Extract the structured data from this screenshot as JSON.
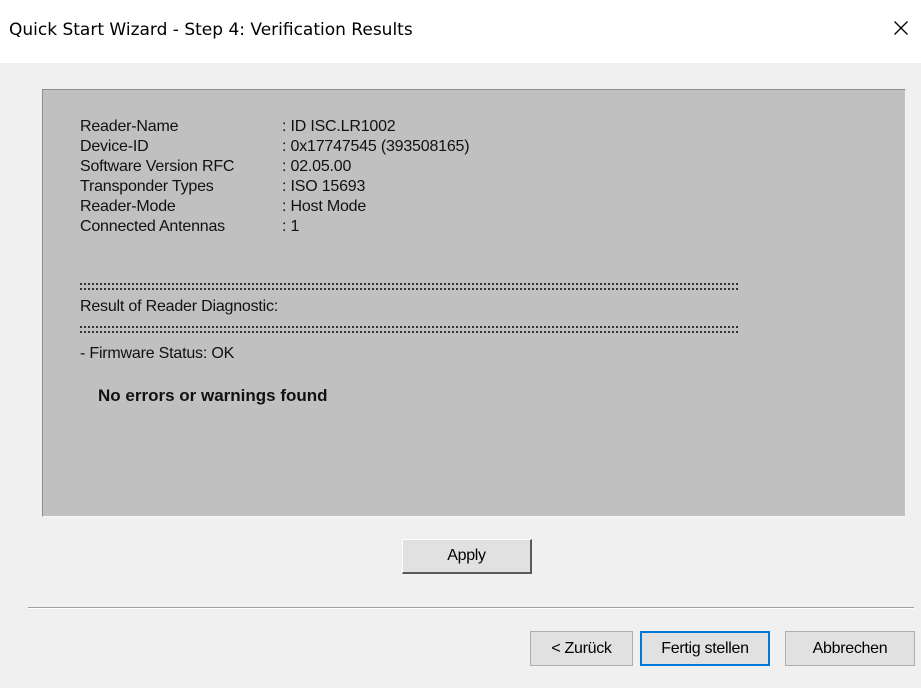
{
  "window": {
    "title": "Quick Start Wizard - Step 4: Verification Results",
    "close_glyph": "✕"
  },
  "report": {
    "fields": [
      {
        "label": "Reader-Name",
        "value": ": ID ISC.LR1002"
      },
      {
        "label": "Device-ID",
        "value": ": 0x17747545 (393508165)"
      },
      {
        "label": "Software Version RFC",
        "value": ": 02.05.00"
      },
      {
        "label": "Transponder Types",
        "value": ": ISO 15693"
      },
      {
        "label": "Reader-Mode",
        "value": ": Host Mode"
      },
      {
        "label": "Connected Antennas",
        "value": ": 1"
      }
    ],
    "diagnostic_heading": "Result of Reader Diagnostic:",
    "firmware_status": "- Firmware Status: OK",
    "summary": "No errors or warnings found"
  },
  "buttons": {
    "apply": "Apply",
    "back": "< Zurück",
    "finish": "Fertig stellen",
    "cancel": "Abbrechen"
  },
  "colors": {
    "panel_background": "#c0c0c0",
    "dialog_background": "#f0f0f0",
    "default_button_border": "#0078d7"
  }
}
